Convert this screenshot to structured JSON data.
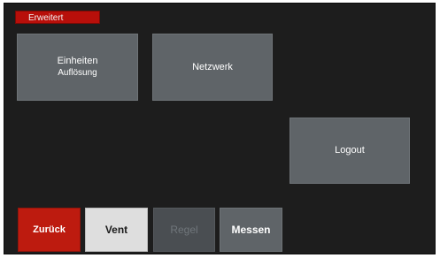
{
  "screen": {
    "title": "Erweitert",
    "title_color": "#b80f0a"
  },
  "tiles": {
    "einheiten": {
      "line1": "Einheiten",
      "line2": "Auflösung"
    },
    "netzwerk": {
      "label": "Netzwerk"
    },
    "logout": {
      "label": "Logout"
    }
  },
  "bottom_bar": {
    "zurueck": {
      "label": "Zurück",
      "color": "#bd1b0f"
    },
    "vent": {
      "label": "Vent"
    },
    "regel": {
      "label": "Regel",
      "state": "disabled"
    },
    "messen": {
      "label": "Messen"
    }
  }
}
